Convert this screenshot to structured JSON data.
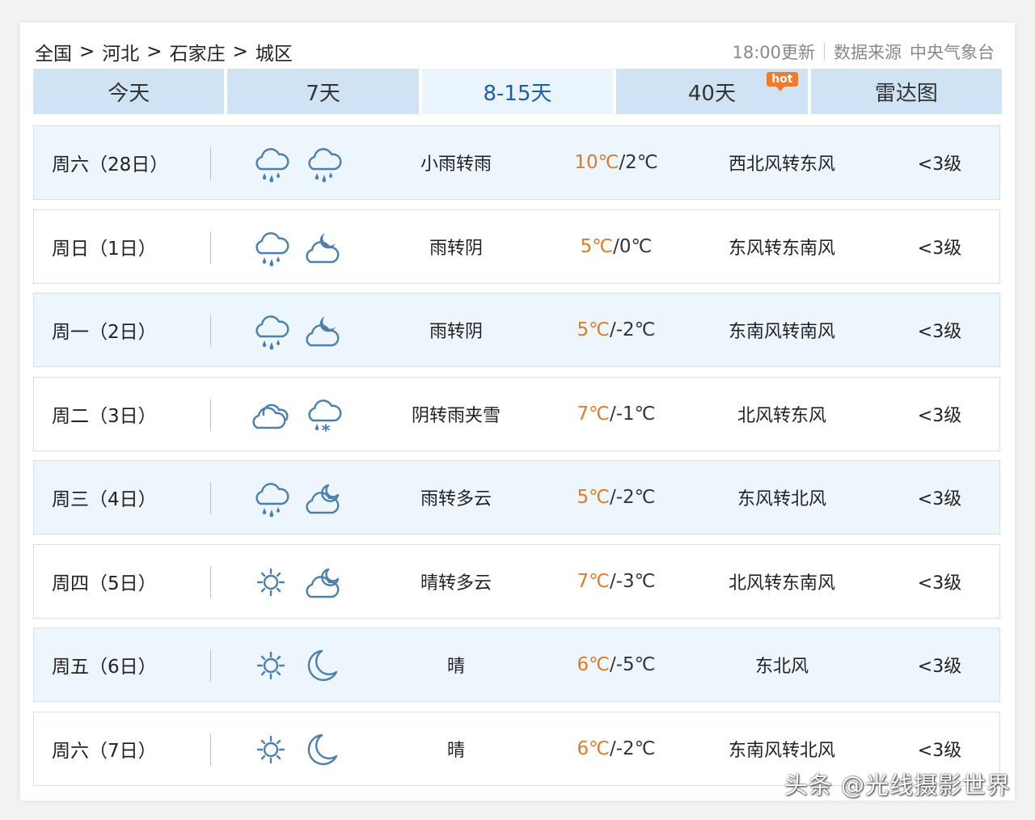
{
  "breadcrumb": [
    "全国",
    "河北",
    "石家庄",
    "城区"
  ],
  "breadcrumb_separator": ">",
  "update_time": "18:00更新",
  "source_label": "数据来源",
  "source": "中央气象台",
  "tabs": [
    {
      "label": "今天"
    },
    {
      "label": "7天"
    },
    {
      "label": "8-15天",
      "active": true
    },
    {
      "label": "40天",
      "badge": "hot"
    },
    {
      "label": "雷达图"
    }
  ],
  "days": [
    {
      "date": "周六（28日）",
      "day_icon": "rain-icon",
      "night_icon": "rain-icon",
      "condition": "小雨转雨",
      "high": "10℃",
      "low": "/2℃",
      "wind": "西北风转东风",
      "level": "<3级"
    },
    {
      "date": "周日（1日）",
      "day_icon": "rain-icon",
      "night_icon": "cloudy-night-icon",
      "condition": "雨转阴",
      "high": "5℃",
      "low": "/0℃",
      "wind": "东风转东南风",
      "level": "<3级"
    },
    {
      "date": "周一（2日）",
      "day_icon": "rain-icon",
      "night_icon": "cloudy-night-icon",
      "condition": "雨转阴",
      "high": "5℃",
      "low": "/-2℃",
      "wind": "东南风转南风",
      "level": "<3级"
    },
    {
      "date": "周二（3日）",
      "day_icon": "overcast-icon",
      "night_icon": "sleet-icon",
      "condition": "阴转雨夹雪",
      "high": "7℃",
      "low": "/-1℃",
      "wind": "北风转东风",
      "level": "<3级"
    },
    {
      "date": "周三（4日）",
      "day_icon": "rain-icon",
      "night_icon": "partly-cloudy-night-icon",
      "condition": "雨转多云",
      "high": "5℃",
      "low": "/-2℃",
      "wind": "东风转北风",
      "level": "<3级"
    },
    {
      "date": "周四（5日）",
      "day_icon": "sun-icon",
      "night_icon": "partly-cloudy-night-icon",
      "condition": "晴转多云",
      "high": "7℃",
      "low": "/-3℃",
      "wind": "北风转东南风",
      "level": "<3级"
    },
    {
      "date": "周五（6日）",
      "day_icon": "sun-icon",
      "night_icon": "moon-icon",
      "condition": "晴",
      "high": "6℃",
      "low": "/-5℃",
      "wind": "东北风",
      "level": "<3级"
    },
    {
      "date": "周六（7日）",
      "day_icon": "sun-icon",
      "night_icon": "moon-icon",
      "condition": "晴",
      "high": "6℃",
      "low": "/-2℃",
      "wind": "东南风转北风",
      "level": "<3级"
    }
  ],
  "colors": {
    "accent": "#1b5fa8",
    "tab_bg": "#cfe3f5",
    "temp_high": "#e07a28",
    "icon": "#4a7fb0"
  },
  "watermark": "头条 @光线摄影世界"
}
